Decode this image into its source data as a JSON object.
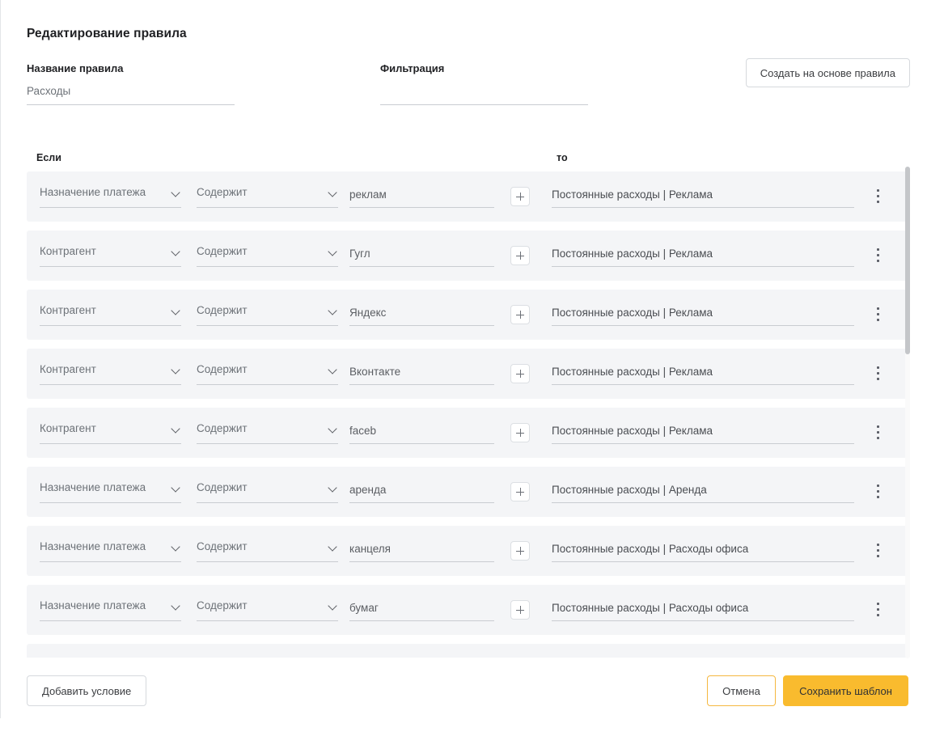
{
  "header": {
    "title": "Редактирование правила",
    "rule_name_label": "Название правила",
    "rule_name_value": "Расходы",
    "filtration_label": "Фильтрация",
    "filtration_value": "",
    "filtration_placeholder": "",
    "create_from_rule_button": "Создать на основе правила"
  },
  "table": {
    "col_if": "Если",
    "col_then": "то",
    "add_icon": "plus-icon",
    "menu_icon": "kebab-menu-icon",
    "chevron_icon": "chevron-down-icon",
    "rows": [
      {
        "field": "Назначение платежа",
        "operator": "Содержит",
        "value": "реклам",
        "result": "Постоянные расходы | Реклама"
      },
      {
        "field": "Контрагент",
        "operator": "Содержит",
        "value": "Гугл",
        "result": "Постоянные расходы | Реклама"
      },
      {
        "field": "Контрагент",
        "operator": "Содержит",
        "value": "Яндекс",
        "result": "Постоянные расходы | Реклама"
      },
      {
        "field": "Контрагент",
        "operator": "Содержит",
        "value": "Вконтакте",
        "result": "Постоянные расходы | Реклама"
      },
      {
        "field": "Контрагент",
        "operator": "Содержит",
        "value": "faceb",
        "result": "Постоянные расходы | Реклама"
      },
      {
        "field": "Назначение платежа",
        "operator": "Содержит",
        "value": "аренда",
        "result": "Постоянные расходы | Аренда"
      },
      {
        "field": "Назначение платежа",
        "operator": "Содержит",
        "value": "канцеля",
        "result": "Постоянные расходы | Расходы офиса"
      },
      {
        "field": "Назначение платежа",
        "operator": "Содержит",
        "value": "бумаг",
        "result": "Постоянные расходы | Расходы офиса"
      },
      {
        "field": "",
        "operator": "",
        "value": "",
        "result": ""
      }
    ]
  },
  "footer": {
    "add_condition_button": "Добавить условие",
    "cancel_button": "Отмена",
    "save_button": "Сохранить шаблон"
  },
  "colors": {
    "accent": "#f9bb2e",
    "row_bg": "#f4f5f7",
    "underline": "#c9ccd1",
    "text": "#1f2023",
    "muted_text": "#6d7278",
    "scrollbar_thumb": "#c4c6c9"
  }
}
